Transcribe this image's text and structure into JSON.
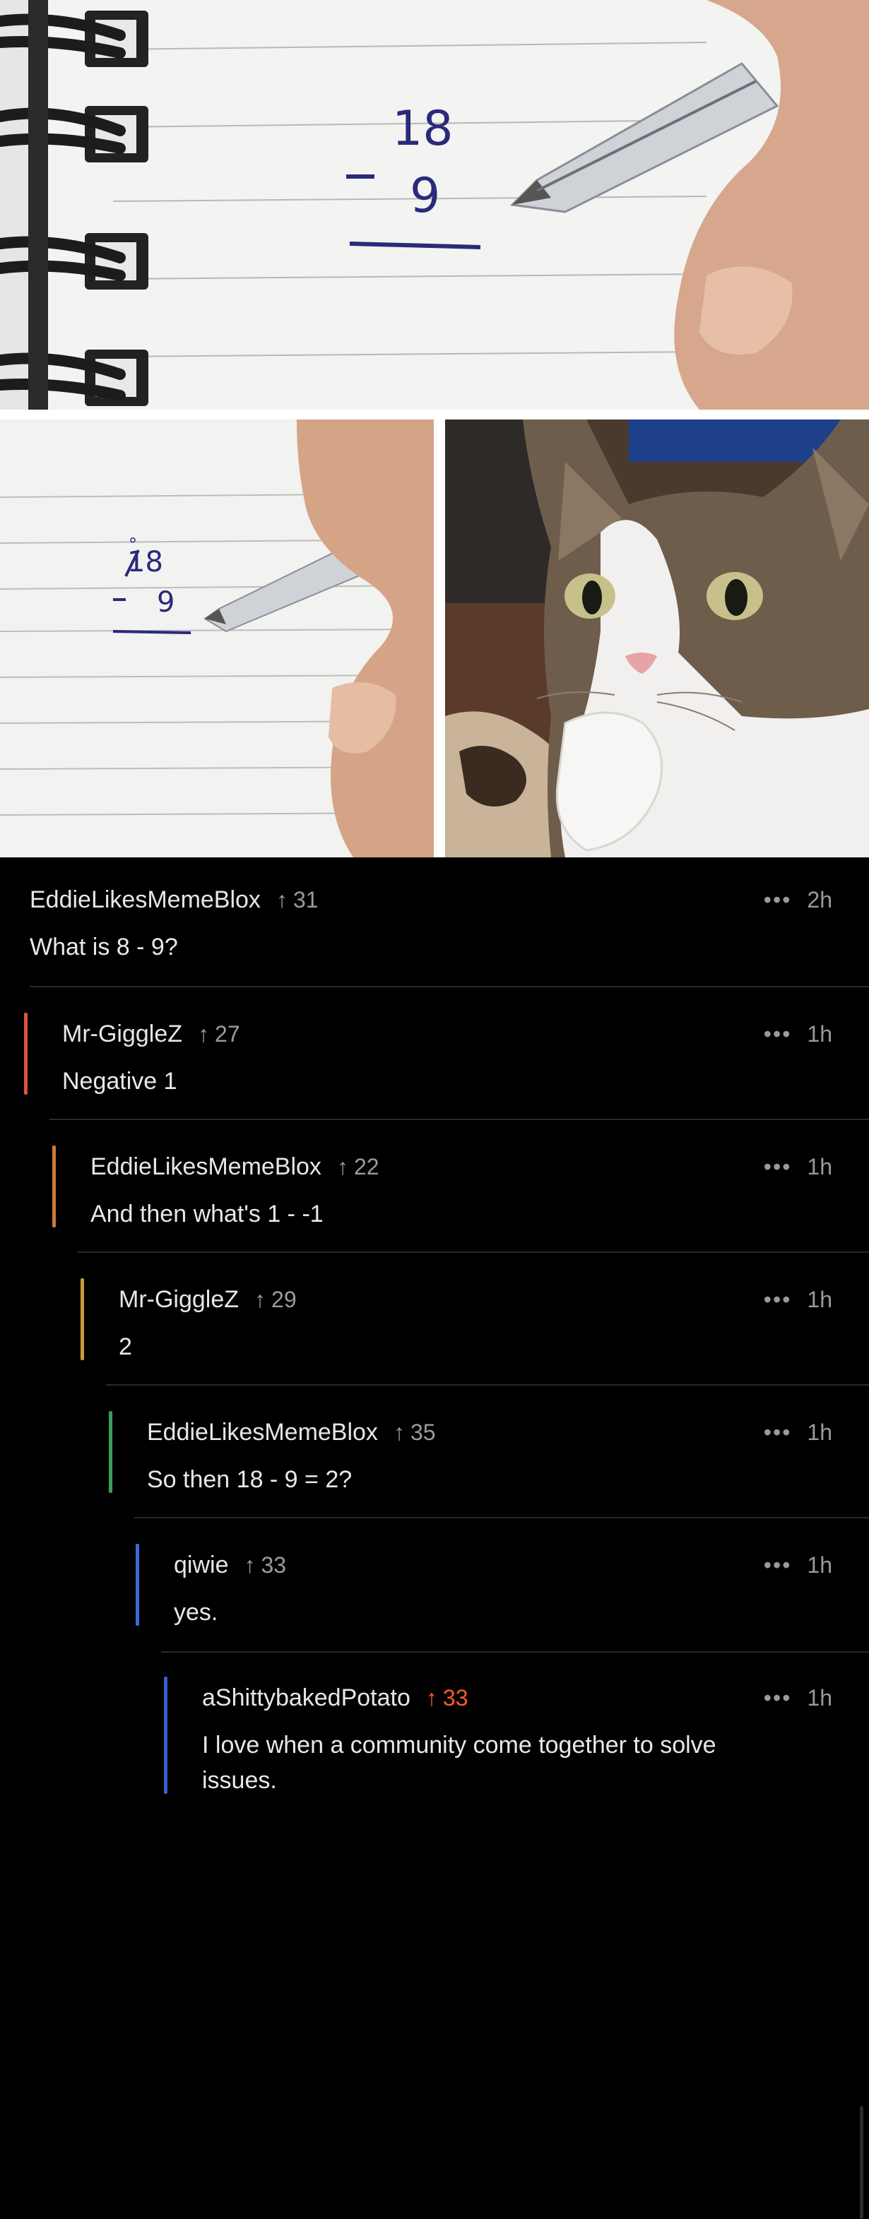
{
  "meme": {
    "panel1_digits": [
      "18",
      "-",
      "9"
    ],
    "panel2_digits": [
      "°",
      "18",
      "-",
      "9"
    ]
  },
  "colors": {
    "background": "#000000",
    "upvote_accent": "#ff5a2a",
    "thread_bars": [
      "#d9553a",
      "#cf7a34",
      "#c99a3a",
      "#3f9a5a",
      "#3a6bd6",
      "#3a5fd0"
    ]
  },
  "comments": [
    {
      "user": "EddieLikesMemeBlox",
      "score": "31",
      "time": "2h",
      "body": "What is 8 - 9?"
    },
    {
      "user": "Mr-GiggleZ",
      "score": "27",
      "time": "1h",
      "body": "Negative 1"
    },
    {
      "user": "EddieLikesMemeBlox",
      "score": "22",
      "time": "1h",
      "body": "And then what's 1 - -1"
    },
    {
      "user": "Mr-GiggleZ",
      "score": "29",
      "time": "1h",
      "body": "2"
    },
    {
      "user": "EddieLikesMemeBlox",
      "score": "35",
      "time": "1h",
      "body": "So then 18 - 9 = 2?"
    },
    {
      "user": "qiwie",
      "score": "33",
      "time": "1h",
      "body": "yes."
    },
    {
      "user": "aShittybakedPotato",
      "score": "33",
      "time": "1h",
      "body": "I love when a community come together to solve issues.",
      "upvoted": true
    }
  ],
  "icons": {
    "upvote": "arrow-up-icon",
    "more": "more-dots-icon"
  }
}
